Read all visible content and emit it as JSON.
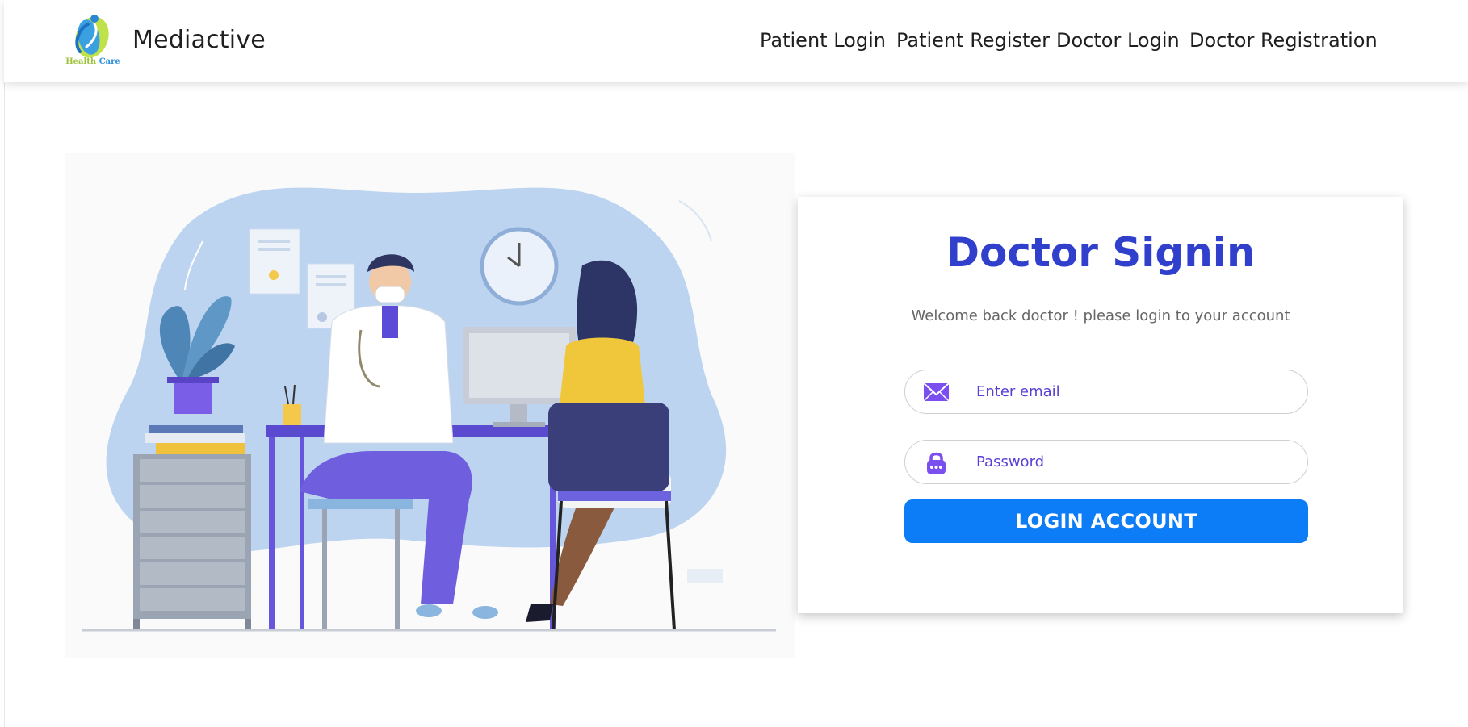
{
  "brand": {
    "logo_icon": "leaf-person-icon",
    "logo_caption_health": "Health",
    "logo_caption_care": "Care",
    "name": "Mediactive"
  },
  "nav": {
    "items": [
      {
        "label": "Patient Login"
      },
      {
        "label": "Patient Register"
      },
      {
        "label": "Doctor Login"
      },
      {
        "label": "Doctor Registration"
      }
    ]
  },
  "login": {
    "title": "Doctor Signin",
    "subtitle": "Welcome back doctor ! please login to your account",
    "email_placeholder": "Enter email",
    "email_value": "",
    "email_icon": "envelope-icon",
    "password_placeholder": "Password",
    "password_value": "",
    "password_icon": "lock-icon",
    "submit_label": "LOGIN ACCOUNT"
  },
  "colors": {
    "title": "#3140cc",
    "button": "#0d7cf7",
    "icon": "#7b4ef0",
    "placeholder": "#5a3fd6"
  }
}
